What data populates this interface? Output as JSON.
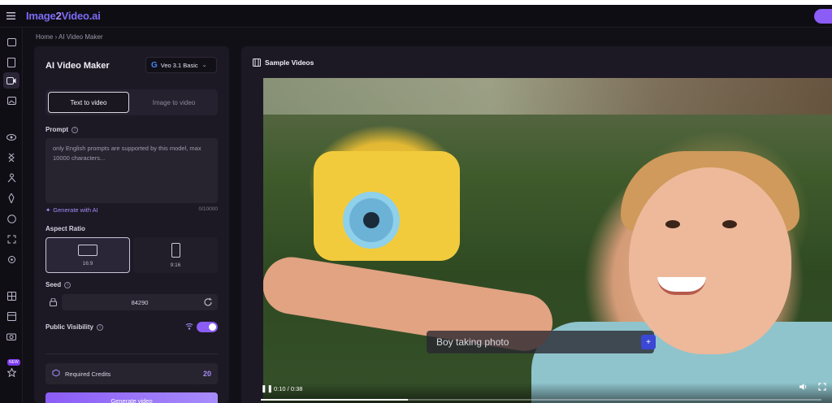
{
  "app": {
    "logo_main": "Image",
    "logo_num": "2",
    "logo_rest": "Video.ai"
  },
  "breadcrumb": "Home › AI Video Maker",
  "panel": {
    "title": "AI Video Maker",
    "model": "Veo 3.1 Basic",
    "tabs": [
      {
        "label": "Text to video",
        "active": true
      },
      {
        "label": "Image to video",
        "active": false
      }
    ],
    "prompt_label": "Prompt",
    "prompt_placeholder": "only English prompts are supported by this model, max 10000 characters...",
    "generate_ai": "Generate with AI",
    "char_count": "0/10000",
    "aspect_label": "Aspect Ratio",
    "ratios": [
      "16:9",
      "9:16"
    ],
    "seed_label": "Seed",
    "seed_value": "84290",
    "visibility_label": "Public Visibility",
    "public_visibility": true,
    "credits_label": "Required Credits",
    "credits_value": "20",
    "generate_button": "Generate video"
  },
  "video_panel": {
    "title": "Sample Videos",
    "caption": "Boy taking photo",
    "time": "0:10 / 0:38",
    "progress": 0.263
  },
  "rail": {
    "badge": "NEW"
  },
  "colors": {
    "accent": "#8b5cf6",
    "background": "#121017",
    "panel": "#1c1924"
  }
}
